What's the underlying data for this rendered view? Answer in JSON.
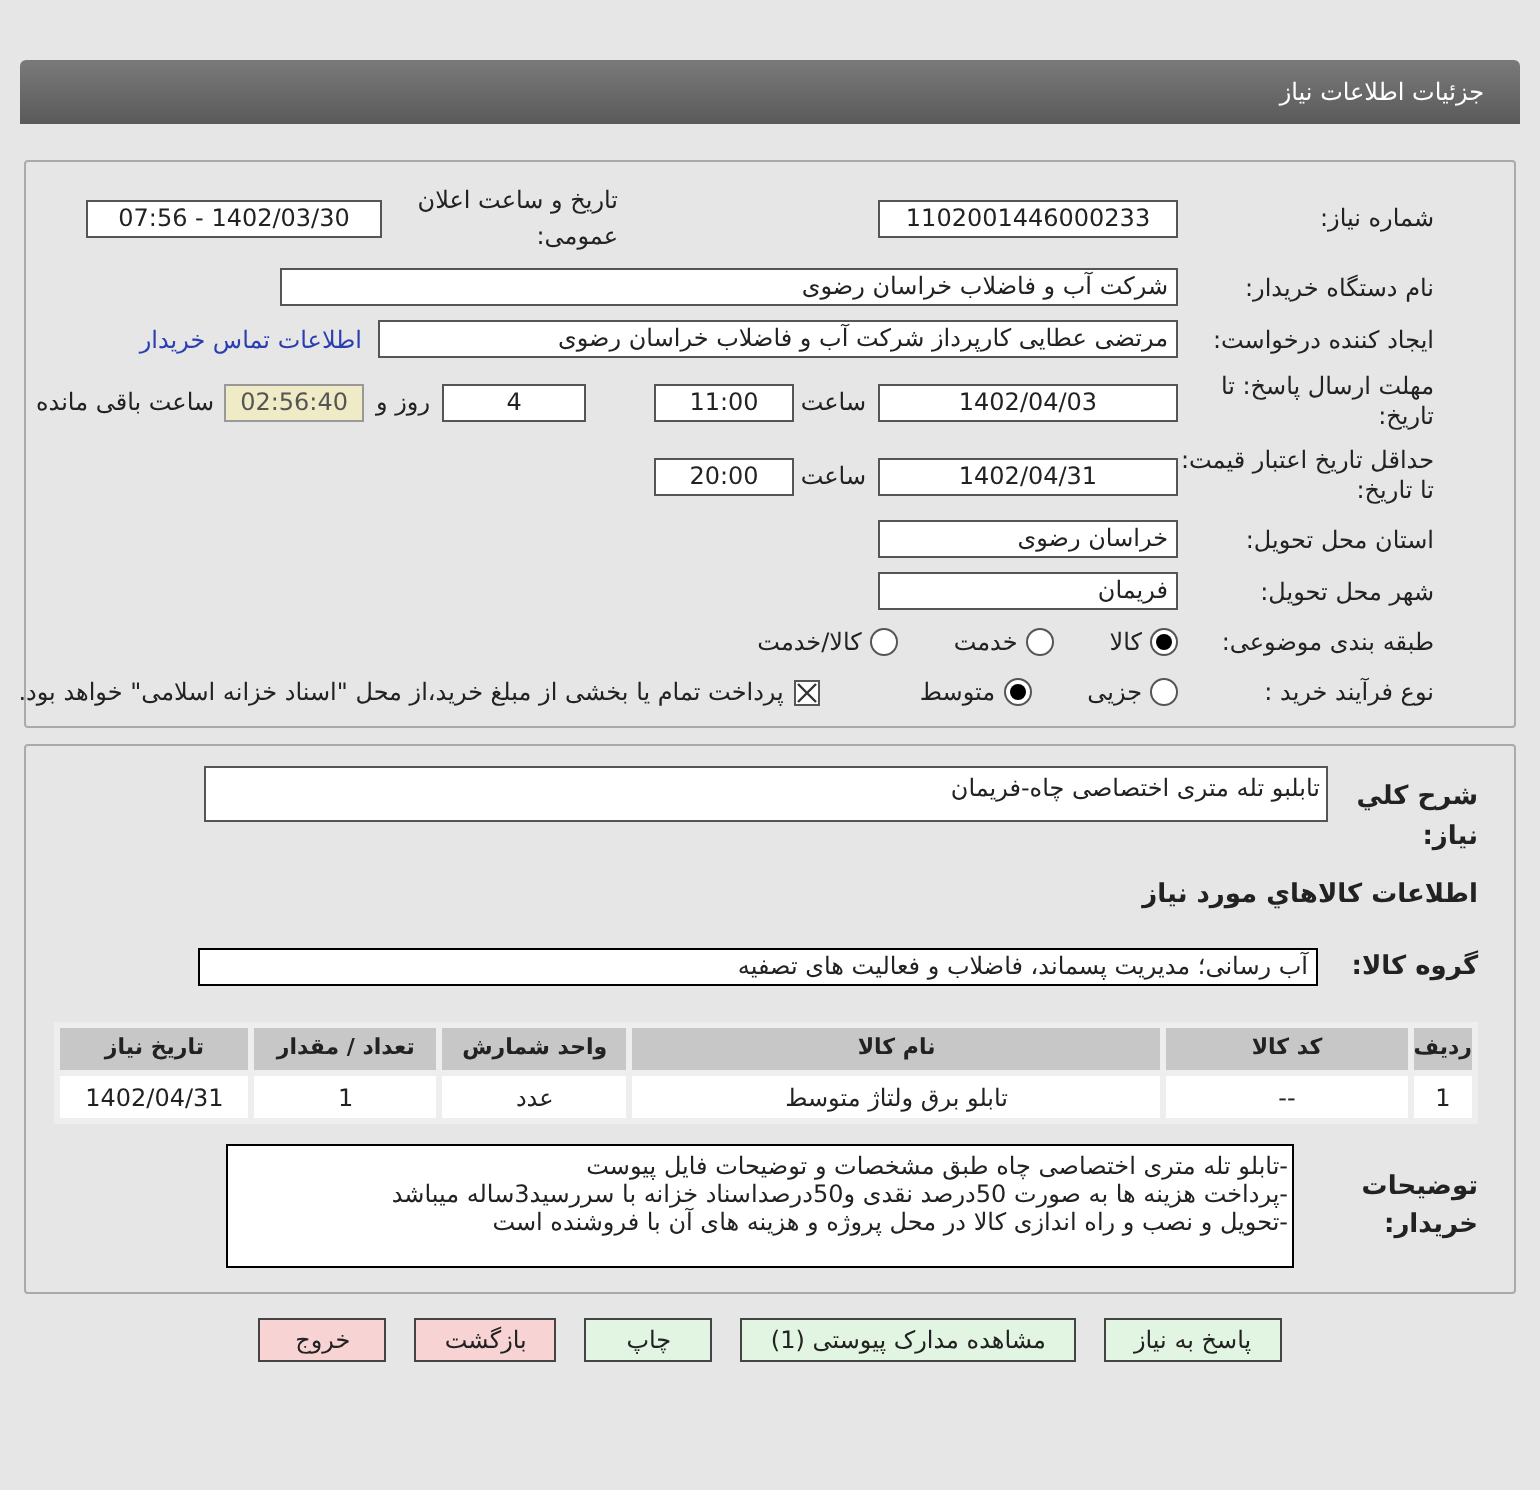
{
  "title": "جزئیات اطلاعات نیاز",
  "need_number": {
    "label": "شماره نیاز:",
    "value": "1102001446000233"
  },
  "announce": {
    "label": "تاریخ و ساعت اعلان عمومی:",
    "value": "1402/03/30 - 07:56"
  },
  "buyer": {
    "label": "نام دستگاه خریدار:",
    "value": "شرکت آب و فاضلاب خراسان رضوی"
  },
  "creator": {
    "label": "ایجاد کننده درخواست:",
    "value": "مرتضی عطایی کارپرداز شرکت آب و فاضلاب خراسان رضوی",
    "link": "اطلاعات تماس خریدار"
  },
  "deadline": {
    "label": "مهلت ارسال پاسخ: تا تاریخ:",
    "date": "1402/04/03",
    "time_label": "ساعت",
    "time": "11:00",
    "days": "4",
    "days_label": "روز و",
    "remaining": "02:56:40",
    "remaining_label": "ساعت باقی مانده"
  },
  "validity": {
    "label": "حداقل تاریخ اعتبار قیمت: تا تاریخ:",
    "date": "1402/04/31",
    "time_label": "ساعت",
    "time": "20:00"
  },
  "province": {
    "label": "استان محل تحویل:",
    "value": "خراسان رضوی"
  },
  "city": {
    "label": "شهر محل تحویل:",
    "value": "فریمان"
  },
  "category": {
    "label": "طبقه بندی موضوعی:",
    "options": [
      {
        "label": "کالا",
        "selected": true
      },
      {
        "label": "خدمت",
        "selected": false
      },
      {
        "label": "کالا/خدمت",
        "selected": false
      }
    ]
  },
  "process": {
    "label": "نوع فرآیند خرید :",
    "options": [
      {
        "label": "جزیی",
        "selected": false
      },
      {
        "label": "متوسط",
        "selected": true
      }
    ],
    "payment": {
      "checked": true,
      "text": "پرداخت تمام یا بخشی از مبلغ خرید،از محل \"اسناد خزانه اسلامی\" خواهد بود."
    }
  },
  "summary": {
    "label": "شرح كلي نياز:",
    "value": "تابلبو تله متری اختصاصی چاه-فریمان"
  },
  "goods_heading": "اطلاعات كالاهاي مورد نياز",
  "goods_group": {
    "label": "گروه کالا:",
    "value": "آب رسانی؛ مدیریت پسماند، فاضلاب و فعالیت های تصفیه"
  },
  "table": {
    "columns": [
      "ردیف",
      "کد کالا",
      "نام کالا",
      "واحد شمارش",
      "تعداد / مقدار",
      "تاریخ نیاز"
    ],
    "rows": [
      [
        "1",
        "--",
        "تابلو برق ولتاژ متوسط",
        "عدد",
        "1",
        "1402/04/31"
      ]
    ]
  },
  "notes": {
    "label": "توضیحات خریدار:",
    "lines": [
      "-تابلو تله متری اختصاصی چاه طبق مشخصات و توضیحات فایل پیوست",
      "-پرداخت هزینه ها به صورت 50درصد نقدی و50درصداسناد خزانه با سررسید3ساله میباشد",
      "-تحویل و نصب و راه اندازی کالا در محل پروژه و هزینه های آن با فروشنده است"
    ]
  },
  "buttons": [
    {
      "label": "پاسخ به نیاز",
      "kind": "normal"
    },
    {
      "label": "مشاهده مدارک پیوستی (1)",
      "kind": "normal"
    },
    {
      "label": "چاپ",
      "kind": "normal"
    },
    {
      "label": "بازگشت",
      "kind": "alert"
    },
    {
      "label": "خروج",
      "kind": "alert"
    }
  ]
}
